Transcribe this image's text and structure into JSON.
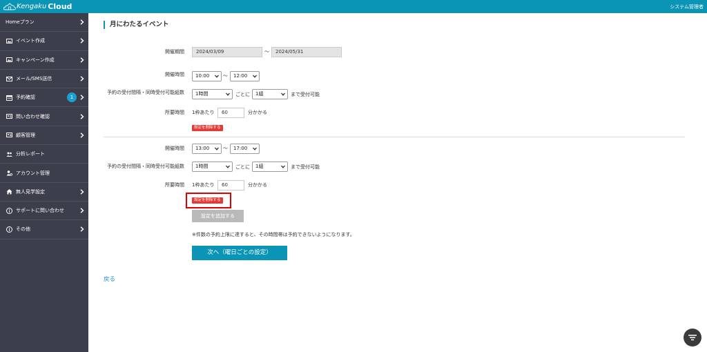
{
  "header": {
    "logo_text_1": "Kengaku",
    "logo_text_2": "Cloud",
    "admin_label": "システム管理者"
  },
  "sidebar": {
    "items": [
      {
        "label": "Homeプラン",
        "icon": "none",
        "chevron": true
      },
      {
        "label": "イベント作成",
        "icon": "image-icon",
        "chevron": true
      },
      {
        "label": "キャンペーン作成",
        "icon": "image-icon",
        "chevron": true
      },
      {
        "label": "メール/SMS送信",
        "icon": "mail-icon",
        "chevron": true
      },
      {
        "label": "予約確認",
        "icon": "calendar-icon",
        "chevron": true,
        "badge": "1"
      },
      {
        "label": "問い合わせ確認",
        "icon": "id-card-icon",
        "chevron": true
      },
      {
        "label": "顧客管理",
        "icon": "id-card-icon",
        "chevron": true
      },
      {
        "label": "分析レポート",
        "icon": "users-icon",
        "chevron": false
      },
      {
        "label": "アカウント管理",
        "icon": "user-gear-icon",
        "chevron": false
      },
      {
        "label": "無人見学設定",
        "icon": "home-icon",
        "chevron": true
      },
      {
        "label": "サポートに問い合わせ",
        "icon": "info-icon",
        "chevron": true
      },
      {
        "label": "その他",
        "icon": "info-icon",
        "chevron": true
      }
    ]
  },
  "main": {
    "title": "月にわたるイベント",
    "period_label": "開催期間",
    "period_start": "2024/03/09",
    "period_sep": "〜",
    "period_end": "2024/05/31",
    "blocks": [
      {
        "time_label": "開催時間",
        "start_time": "10:00",
        "time_sep": "〜",
        "end_time": "12:00",
        "interval_label": "予約の受付間隔・同時受付可能組数",
        "interval_value": "1時間",
        "interval_mid": "ごとに",
        "groups_value": "1組",
        "interval_tail": "まで受付可能",
        "duration_label": "所要時間",
        "duration_prefix": "1枠あたり",
        "duration_value": "60",
        "duration_suffix": "分かかる",
        "delete_label": "設定を削除する"
      },
      {
        "time_label": "開催時間",
        "start_time": "13:00",
        "time_sep": "〜",
        "end_time": "17:00",
        "interval_label": "予約の受付間隔・同時受付可能組数",
        "interval_value": "1時間",
        "interval_mid": "ごとに",
        "groups_value": "1組",
        "interval_tail": "まで受付可能",
        "duration_label": "所要時間",
        "duration_prefix": "1枠あたり",
        "duration_value": "60",
        "duration_suffix": "分かかる",
        "delete_label": "設定を削除する"
      }
    ],
    "add_label": "設定を追加する",
    "note": "※件数の予約上限に達すると、その時間帯は予約できないようになります。",
    "next_label": "次へ（曜日ごとの設定）",
    "back_label": "戻る"
  },
  "colors": {
    "header": "#0a94b5",
    "sidebar": "#3c3f4b",
    "delete": "#e53935",
    "highlight": "#e00000",
    "next": "#0a94b5"
  }
}
